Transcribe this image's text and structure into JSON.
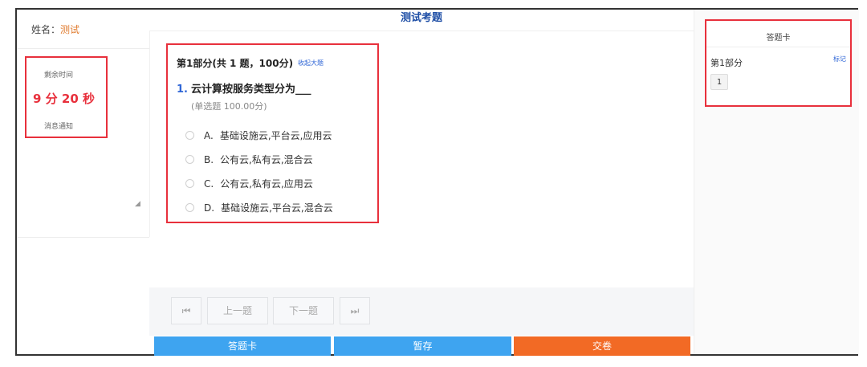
{
  "left": {
    "name_label": "姓名：",
    "name_value": "测试",
    "timer_label": "剩余时间",
    "timer_value": "9 分 20 秒",
    "notice_label": "消息通知"
  },
  "header": {
    "title": "测试考题"
  },
  "question": {
    "section_head": "第1部分(共 1 题，100分)",
    "collapse_link": "收起大题",
    "number": "1.",
    "text": "云计算按服务类型分为___",
    "meta": "(单选题 100.00分)",
    "options": [
      {
        "letter": "A.",
        "text": "基础设施云,平台云,应用云"
      },
      {
        "letter": "B.",
        "text": "公有云,私有云,混合云"
      },
      {
        "letter": "C.",
        "text": "公有云,私有云,应用云"
      },
      {
        "letter": "D.",
        "text": "基础设施云,平台云,混合云"
      }
    ]
  },
  "nav": {
    "first_icon": "skip-first-icon",
    "prev_label": "上一题",
    "next_label": "下一题",
    "last_icon": "skip-last-icon"
  },
  "actions": {
    "card_label": "答题卡",
    "save_label": "暂存",
    "submit_label": "交卷"
  },
  "answer_card": {
    "title": "答题卡",
    "section": "第1部分",
    "mark_label": "标记",
    "items": [
      "1"
    ]
  },
  "colors": {
    "accent_blue": "#3ea4f0",
    "submit_orange": "#f26a25",
    "timer_red": "#e8303c",
    "title_blue": "#1f4fa6"
  }
}
